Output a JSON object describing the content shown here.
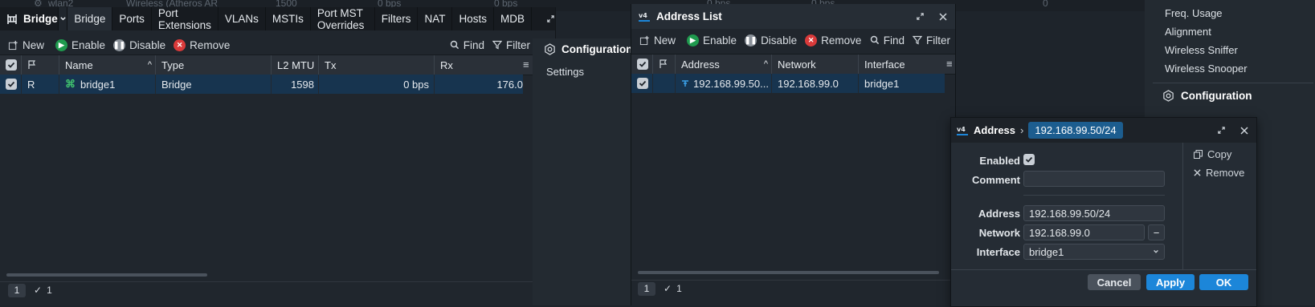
{
  "background_strip": {
    "iface_name": "wlan2",
    "iface_type": "Wireless (Atheros AR",
    "mtu": "1500",
    "tx1": "0 bps",
    "tx2": "0 bps",
    "tx3": "0 bps",
    "tx4": "0 bps",
    "count": "0"
  },
  "bridge_window": {
    "title": "Bridge",
    "tabs": [
      "Bridge",
      "Ports",
      "Port Extensions",
      "VLANs",
      "MSTIs",
      "Port MST Overrides",
      "Filters",
      "NAT",
      "Hosts",
      "MDB"
    ],
    "toolbar": {
      "new": "New",
      "enable": "Enable",
      "disable": "Disable",
      "remove": "Remove",
      "find": "Find",
      "filter": "Filter"
    },
    "columns": [
      "Name",
      "Type",
      "L2 MTU",
      "Tx",
      "Rx"
    ],
    "rows": [
      {
        "flag": "R",
        "name": "bridge1",
        "type": "Bridge",
        "l2mtu": "1598",
        "tx": "0 bps",
        "rx": "176.0"
      }
    ],
    "status": {
      "page": "1",
      "count": "1"
    }
  },
  "config_panel": {
    "title": "Configuration",
    "items": [
      "Settings"
    ]
  },
  "address_list_window": {
    "title": "Address List",
    "toolbar": {
      "new": "New",
      "enable": "Enable",
      "disable": "Disable",
      "remove": "Remove",
      "find": "Find",
      "filter": "Filter"
    },
    "columns": [
      "Address",
      "Network",
      "Interface"
    ],
    "rows": [
      {
        "address": "192.168.99.50...",
        "network": "192.168.99.0",
        "interface": "bridge1"
      }
    ],
    "status": {
      "page": "1",
      "count": "1"
    }
  },
  "right_panel": {
    "links": [
      "Freq. Usage",
      "Alignment",
      "Wireless Sniffer",
      "Wireless Snooper"
    ],
    "section_title": "Configuration"
  },
  "address_dialog": {
    "breadcrumb_root": "Address",
    "breadcrumb_sep": "›",
    "breadcrumb_current": "192.168.99.50/24",
    "labels": {
      "enabled": "Enabled",
      "comment": "Comment",
      "address": "Address",
      "network": "Network",
      "interface": "Interface"
    },
    "values": {
      "enabled": true,
      "comment": "",
      "address": "192.168.99.50/24",
      "network": "192.168.99.0",
      "interface": "bridge1"
    },
    "actions": {
      "copy": "Copy",
      "remove": "Remove"
    },
    "buttons": {
      "cancel": "Cancel",
      "apply": "Apply",
      "ok": "OK"
    }
  },
  "colors": {
    "accent": "#1c86d9",
    "selection": "#17344f",
    "enable_green": "#1f9a4e",
    "remove_red": "#d93a3a",
    "disable_gray": "#8a9199"
  }
}
